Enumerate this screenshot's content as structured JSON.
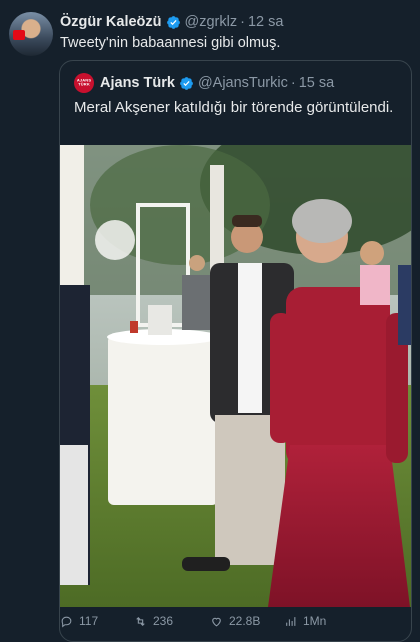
{
  "author": {
    "name": "Özgür Kaleözü",
    "handle": "@zgrklz",
    "time": "12 sa"
  },
  "tweet_text": "Tweety'nin babaannesi gibi olmuş.",
  "quoted": {
    "avatar_text": "AJANS TÜRK",
    "name": "Ajans Türk",
    "handle": "@AjansTurkic",
    "time": "15 sa",
    "text": "Meral Akşener katıldığı bir törende görüntülendi."
  },
  "separator": "·",
  "metrics": {
    "replies": "117",
    "retweets": "236",
    "likes": "22.8B",
    "views": "1Mn"
  },
  "icons": [
    "verified-badge-icon",
    "reply-icon",
    "retweet-icon",
    "like-icon",
    "views-icon"
  ],
  "colors": {
    "background": "#15202b",
    "text": "#e7e9ea",
    "muted": "#8b98a5",
    "verified": "#1d9bf0",
    "border": "#38444d"
  }
}
